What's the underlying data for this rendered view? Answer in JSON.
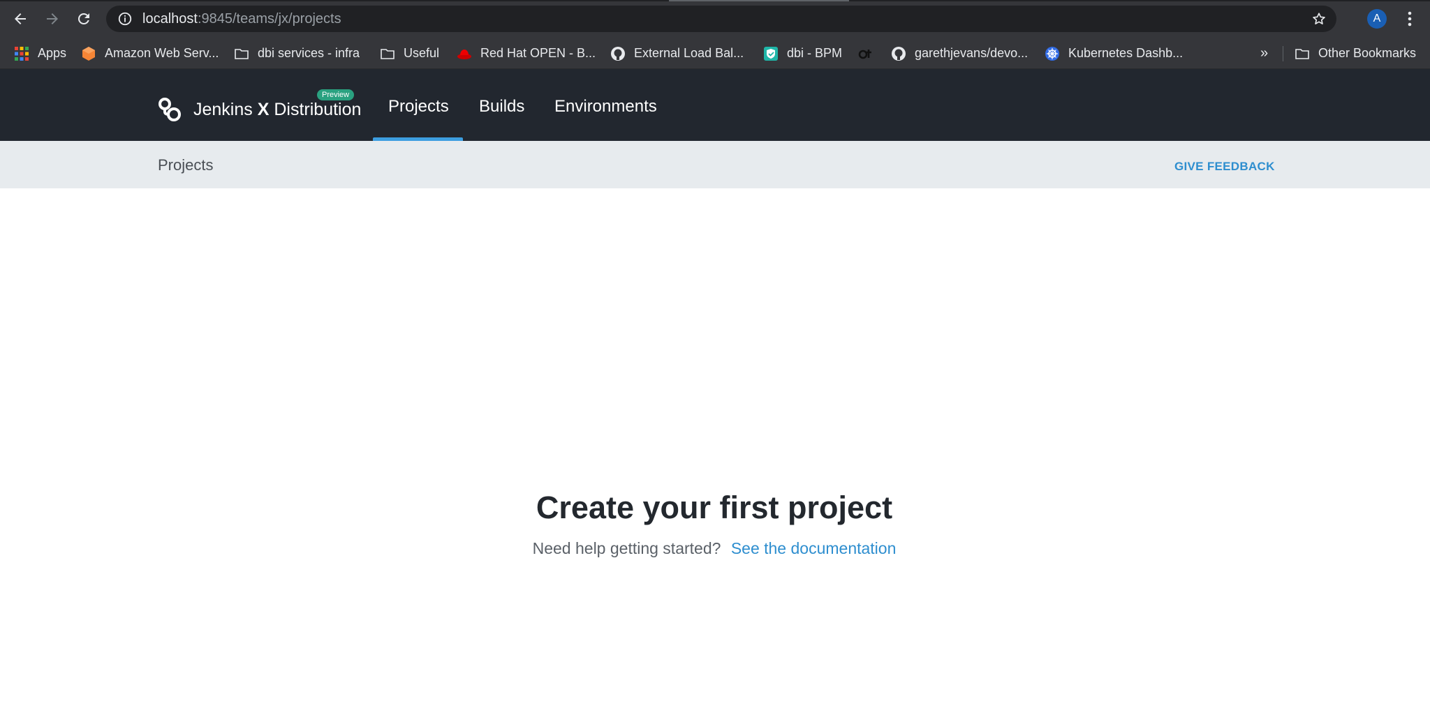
{
  "browser": {
    "url_host": "localhost",
    "url_rest": ":9845/teams/jx/projects",
    "profile_initial": "A",
    "icons": {
      "back": "arrow-left-icon",
      "forward": "arrow-right-icon",
      "reload": "reload-icon",
      "info": "info-icon",
      "bookmark": "star-icon",
      "menu": "kebab-menu-icon"
    }
  },
  "bookmarks": {
    "items": [
      {
        "label": "Apps",
        "icon": "apps-grid-icon"
      },
      {
        "label": "Amazon Web Serv...",
        "icon": "aws-icon"
      },
      {
        "label": "dbi services - infra",
        "icon": "folder-icon"
      },
      {
        "label": "Useful",
        "icon": "folder-icon"
      },
      {
        "label": "Red Hat OPEN - B...",
        "icon": "redhat-icon"
      },
      {
        "label": "External Load Bal...",
        "icon": "github-icon"
      },
      {
        "label": "dbi - BPM",
        "icon": "shield-icon"
      },
      {
        "label": "",
        "icon": "ot-logo-icon"
      },
      {
        "label": "garethjevans/devo...",
        "icon": "github-icon"
      },
      {
        "label": "Kubernetes Dashb...",
        "icon": "kubernetes-icon"
      }
    ],
    "overflow": "»",
    "other": "Other Bookmarks"
  },
  "app": {
    "brand_prefix": "Jenkins ",
    "brand_x": "X",
    "brand_suffix": " Distribution",
    "badge": "Preview",
    "nav": [
      {
        "label": "Projects",
        "active": true
      },
      {
        "label": "Builds",
        "active": false
      },
      {
        "label": "Environments",
        "active": false
      }
    ],
    "accent_color": "#3d9ee0"
  },
  "subheader": {
    "title": "Projects",
    "feedback": "GIVE FEEDBACK"
  },
  "empty_state": {
    "title": "Create your first project",
    "help": "Need help getting started?",
    "link": "See the documentation"
  }
}
